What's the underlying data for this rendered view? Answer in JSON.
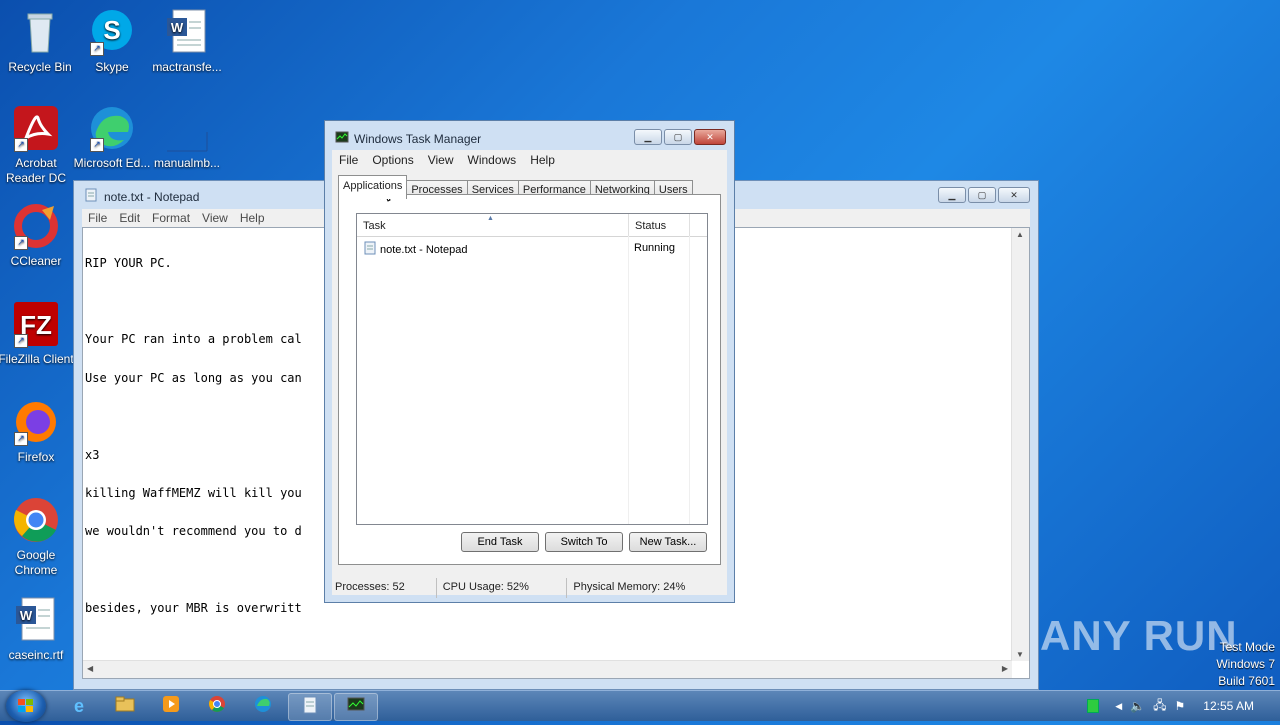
{
  "desktop": {
    "icons": [
      {
        "label": "Recycle Bin"
      },
      {
        "label": "Skype"
      },
      {
        "label": "mactransfe..."
      },
      {
        "label": "Acrobat Reader DC"
      },
      {
        "label": "Microsoft Ed..."
      },
      {
        "label": "manualmb..."
      },
      {
        "label": "CCleaner"
      },
      {
        "label": "FileZilla Client"
      },
      {
        "label": "Firefox"
      },
      {
        "label": "Google Chrome"
      },
      {
        "label": "caseinc.rtf"
      }
    ]
  },
  "notepad": {
    "title": "note.txt - Notepad",
    "menu": [
      "File",
      "Edit",
      "Format",
      "View",
      "Help"
    ],
    "lines": [
      "RIP YOUR PC.",
      "",
      "Your PC ran into a problem cal",
      "Use your PC as long as you can",
      "",
      "x3",
      "killing WaffMEMZ will kill you",
      "we wouldn't recommend you to d",
      "",
      "besides, your MBR is overwritt"
    ]
  },
  "taskmanager": {
    "title": "Windows Task Manager",
    "menu": [
      "File",
      "Options",
      "View",
      "Windows",
      "Help"
    ],
    "tabs": [
      "Applications",
      "Processes",
      "Services",
      "Performance",
      "Networking",
      "Users"
    ],
    "columns": {
      "task": "Task",
      "status": "Status"
    },
    "rows": [
      {
        "task": "note.txt - Notepad",
        "status": "Running"
      }
    ],
    "buttons": {
      "end_task": "End Task",
      "switch_to": "Switch To",
      "new_task": "New Task..."
    },
    "status": {
      "processes": "Processes: 52",
      "cpu": "CPU Usage: 52%",
      "memory": "Physical Memory: 24%"
    }
  },
  "watermark": {
    "line1": "Test Mode",
    "line2": "Windows 7",
    "line3": "Build 7601",
    "brand": "ANY RUN"
  },
  "taskbar": {
    "clock": "12:55 AM"
  }
}
